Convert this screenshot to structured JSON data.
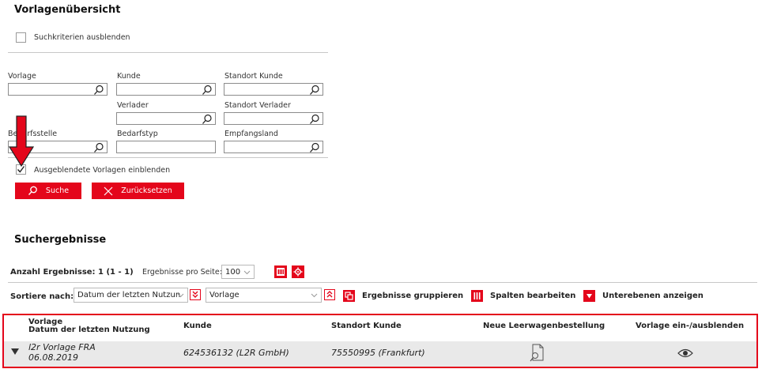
{
  "search": {
    "title": "Vorlagenübersicht",
    "hide_criteria_label": "Suchkriterien ausblenden",
    "fields": {
      "vorlage": {
        "label": "Vorlage",
        "value": ""
      },
      "kunde": {
        "label": "Kunde",
        "value": ""
      },
      "standort_kunde": {
        "label": "Standort Kunde",
        "value": ""
      },
      "verlader": {
        "label": "Verlader",
        "value": ""
      },
      "standort_verlader": {
        "label": "Standort Verlader",
        "value": ""
      },
      "bedarfsstelle": {
        "label": "Bedarfsstelle",
        "value": ""
      },
      "bedarfstyp": {
        "label": "Bedarfstyp",
        "value": ""
      },
      "empfangsland": {
        "label": "Empfangsland",
        "value": ""
      }
    },
    "show_hidden_label": "Ausgeblendete Vorlagen einblenden",
    "show_hidden_checked": true,
    "search_button": "Suche",
    "reset_button": "Zurücksetzen"
  },
  "results": {
    "title": "Suchergebnisse",
    "count_label": "Anzahl Ergebnisse: 1 (1 - 1)",
    "per_page_label": "Ergebnisse pro Seite:",
    "per_page_value": "100",
    "sort_label": "Sortiere nach:",
    "sort_primary": "Datum der letzten Nutzun",
    "sort_secondary": "Vorlage",
    "group_label": "Ergebnisse gruppieren",
    "columns_label": "Spalten bearbeiten",
    "sublevels_label": "Unterebenen anzeigen",
    "table": {
      "headers": {
        "vorlage": "Vorlage",
        "datum": "Datum der letzten Nutzung",
        "kunde": "Kunde",
        "standort": "Standort Kunde",
        "neue": "Neue Leerwagenbestellung",
        "toggle": "Vorlage ein-/ausblenden"
      },
      "rows": [
        {
          "vorlage": "l2r Vorlage FRA",
          "datum": "06.08.2019",
          "kunde": "624536132 (L2R GmbH)",
          "standort": "75550995 (Frankfurt)"
        }
      ]
    }
  },
  "colors": {
    "accent": "#e4061b",
    "highlight_box": "#e4061b"
  }
}
